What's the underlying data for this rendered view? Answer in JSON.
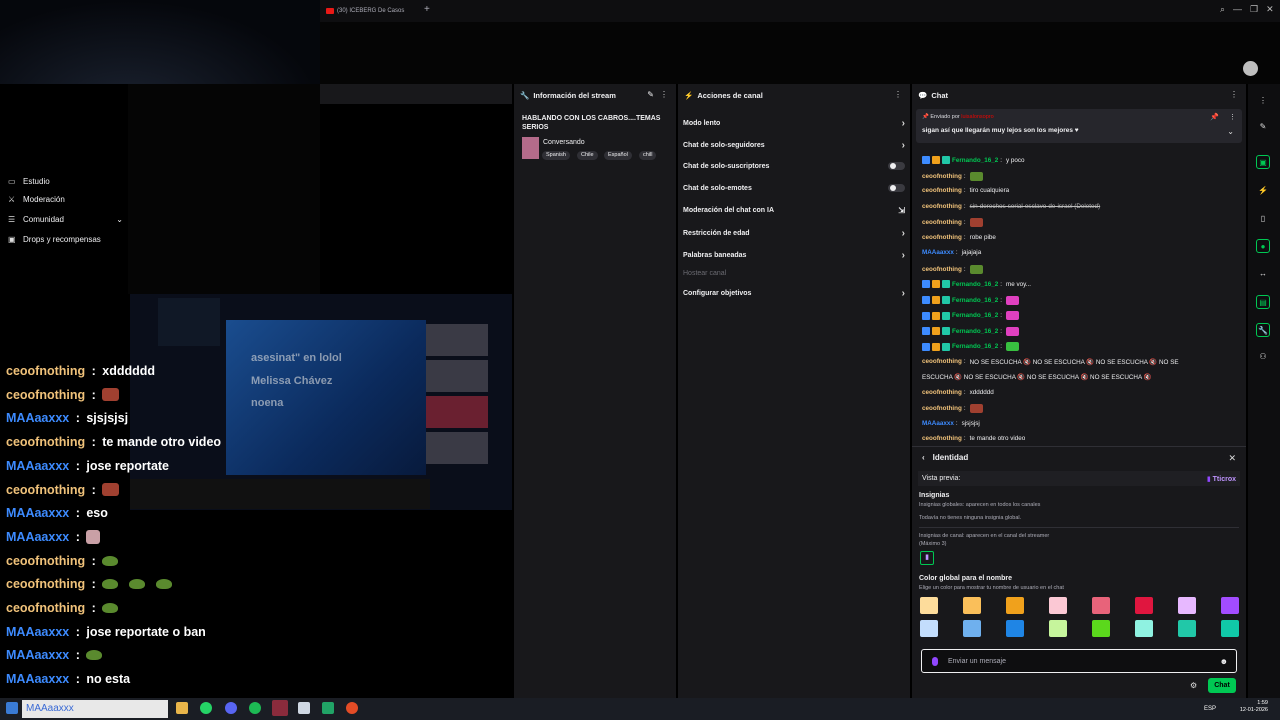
{
  "browser": {
    "tab_title": "(30) ICEBERG De Casos",
    "new_tab": "+",
    "window_controls": [
      "⌕",
      "—",
      "❐",
      "✕"
    ]
  },
  "left_menu": {
    "items": [
      {
        "label": "Estudio",
        "icon": "studio-icon"
      },
      {
        "label": "Moderación",
        "icon": "sword-icon"
      },
      {
        "label": "Comunidad",
        "icon": "people-icon"
      },
      {
        "label": "Drops y recompensas",
        "icon": "gift-icon"
      }
    ]
  },
  "overlay_chat": [
    {
      "user": "ceoofnothing",
      "sep": " : ",
      "text": "xdddddd",
      "emotes": 0,
      "emote_type": "",
      "color": "#f0c27a"
    },
    {
      "user": "ceoofnothing",
      "sep": " : ",
      "text": "",
      "emotes": 1,
      "emote_type": "face",
      "color": "#f0c27a"
    },
    {
      "user": "MAAaaxxx",
      "sep": " : ",
      "text": "sjsjsjsj",
      "emotes": 0,
      "emote_type": "",
      "color": "#3d8bff"
    },
    {
      "user": "ceoofnothing",
      "sep": " : ",
      "text": "te mande otro video",
      "emotes": 0,
      "emote_type": "",
      "color": "#f0c27a"
    },
    {
      "user": "MAAaaxxx",
      "sep": " : ",
      "text": "jose reportate",
      "emotes": 0,
      "emote_type": "",
      "color": "#3d8bff"
    },
    {
      "user": "ceoofnothing",
      "sep": " : ",
      "text": "",
      "emotes": 1,
      "emote_type": "face",
      "color": "#f0c27a"
    },
    {
      "user": "MAAaaxxx",
      "sep": " : ",
      "text": "eso",
      "emotes": 0,
      "emote_type": "",
      "color": "#3d8bff"
    },
    {
      "user": "MAAaaxxx",
      "sep": " : ",
      "text": "",
      "emotes": 1,
      "emote_type": "hand",
      "color": "#3d8bff"
    },
    {
      "user": "ceoofnothing",
      "sep": " : ",
      "text": "",
      "emotes": 1,
      "emote_type": "frog",
      "color": "#f0c27a"
    },
    {
      "user": "ceoofnothing",
      "sep": " : ",
      "text": "",
      "emotes": 3,
      "emote_type": "frog",
      "color": "#f0c27a"
    },
    {
      "user": "ceoofnothing",
      "sep": " : ",
      "text": "",
      "emotes": 1,
      "emote_type": "frog",
      "color": "#f0c27a"
    },
    {
      "user": "MAAaaxxx",
      "sep": " : ",
      "text": "jose reportate o ban",
      "emotes": 0,
      "emote_type": "",
      "color": "#3d8bff"
    },
    {
      "user": "MAAaaxxx",
      "sep": " : ",
      "text": "",
      "emotes": 1,
      "emote_type": "frog",
      "color": "#3d8bff"
    },
    {
      "user": "MAAaaxxx",
      "sep": " : ",
      "text": "no esta",
      "emotes": 0,
      "emote_type": "",
      "color": "#3d8bff"
    }
  ],
  "overlay_preview_texts": [
    "asesinat\" en lolol",
    "Melissa Chávez",
    "noena"
  ],
  "stream_info": {
    "header": "Información del stream",
    "title": "HABLANDO CON LOS CABROS....TEMAS SERIOS",
    "category": "Conversando",
    "tags": [
      "Spanish",
      "Chile",
      "Español",
      "chill"
    ]
  },
  "channel_actions": {
    "header": "Acciones de canal",
    "items": [
      {
        "label": "Modo lento",
        "kind": "chevron"
      },
      {
        "label": "Chat de solo-seguidores",
        "kind": "chevron"
      },
      {
        "label": "Chat de solo-suscriptores",
        "kind": "toggle"
      },
      {
        "label": "Chat de solo-emotes",
        "kind": "toggle"
      },
      {
        "label": "Moderación del chat con IA",
        "kind": "external"
      },
      {
        "label": "Restricción de edad",
        "kind": "chevron"
      },
      {
        "label": "Palabras baneadas",
        "kind": "chevron"
      },
      {
        "label": "Hostear canal",
        "kind": "disabled"
      },
      {
        "label": "Configurar objetivos",
        "kind": "chevron"
      }
    ]
  },
  "chat": {
    "header": "Chat",
    "pinned": {
      "sent_by_prefix": "Enviado por",
      "sent_by_user": "luisalonsopro",
      "message": "sigan así que llegarán muy lejos son los mejores ♥"
    },
    "messages": [
      {
        "user": "Fernando_16_2",
        "text": "y poco",
        "color": "#00c853",
        "badges": true,
        "emote": ""
      },
      {
        "user": "ceoofnothing",
        "text": "",
        "color": "#f0c27a",
        "badges": false,
        "emote": "frog"
      },
      {
        "user": "ceoofnothing",
        "text": "tiro cualquiera",
        "color": "#f0c27a",
        "badges": false,
        "emote": ""
      },
      {
        "user": "ceoofnothing",
        "text": "sin-derechos-serial-esclavo-de-israel (Deleted)",
        "color": "#f0c27a",
        "badges": false,
        "emote": "",
        "deleted": true
      },
      {
        "user": "ceoofnothing",
        "text": "",
        "color": "#f0c27a",
        "badges": false,
        "emote": "face"
      },
      {
        "user": "ceoofnothing",
        "text": "robe pibe",
        "color": "#f0c27a",
        "badges": false,
        "emote": ""
      },
      {
        "user": "MAAaaxxx",
        "text": "jajajaja",
        "color": "#3d8bff",
        "badges": false,
        "emote": ""
      },
      {
        "user": "ceoofnothing",
        "text": "",
        "color": "#f0c27a",
        "badges": false,
        "emote": "frog"
      },
      {
        "user": "Fernando_16_2",
        "text": "me voy...",
        "color": "#00c853",
        "badges": true,
        "emote": ""
      },
      {
        "user": "Fernando_16_2",
        "text": "",
        "color": "#00c853",
        "badges": true,
        "emote": "pink"
      },
      {
        "user": "Fernando_16_2",
        "text": "",
        "color": "#00c853",
        "badges": true,
        "emote": "pink"
      },
      {
        "user": "Fernando_16_2",
        "text": "",
        "color": "#00c853",
        "badges": true,
        "emote": "pink"
      },
      {
        "user": "Fernando_16_2",
        "text": "",
        "color": "#00c853",
        "badges": true,
        "emote": "green"
      },
      {
        "user": "ceoofnothing",
        "text": "NO SE ESCUCHA 🔇 NO SE ESCUCHA 🔇 NO SE ESCUCHA 🔇 NO SE",
        "color": "#f0c27a",
        "badges": false,
        "emote": ""
      },
      {
        "user": "",
        "text": "ESCUCHA 🔇 NO SE ESCUCHA 🔇 NO SE ESCUCHA 🔇 NO SE ESCUCHA 🔇",
        "color": "#f0c27a",
        "badges": false,
        "emote": ""
      },
      {
        "user": "ceoofnothing",
        "text": "xdddddd",
        "color": "#f0c27a",
        "badges": false,
        "emote": ""
      },
      {
        "user": "ceoofnothing",
        "text": "",
        "color": "#f0c27a",
        "badges": false,
        "emote": "face"
      },
      {
        "user": "MAAaaxxx",
        "text": "sjsjsjsj",
        "color": "#3d8bff",
        "badges": false,
        "emote": ""
      },
      {
        "user": "ceoofnothing",
        "text": "te mande otro video",
        "color": "#f0c27a",
        "badges": false,
        "emote": ""
      }
    ],
    "input_placeholder": "Enviar un mensaje",
    "send_label": "Chat"
  },
  "identity": {
    "title": "Identidad",
    "preview_label": "Vista previa:",
    "preview_user": "Tticrox",
    "badges_heading": "Insignias",
    "global_badges_desc": "Insignias globales: aparecen en todos los canales",
    "no_global_badges": "Todavía no tienes ninguna insignia global.",
    "channel_badges_desc": "Insignias de canal: aparecen en el canal del streamer",
    "channel_badges_max": "(Máximo 3)",
    "color_heading": "Color global para el nombre",
    "color_desc": "Elige un color para mostrar tu nombre de usuario en el chat",
    "colors": [
      "#fddc9b",
      "#fabf5a",
      "#f0a11c",
      "#fbc8d4",
      "#e8637a",
      "#e0163f",
      "#e7b8ff",
      "#a24cff",
      "#c3ddfc",
      "#6fb0ee",
      "#1f85e5",
      "#c6f59c",
      "#5bd81c",
      "#8ff2e1",
      "#21c8a8",
      "#10c9a8"
    ]
  },
  "rail_icons": [
    "more-icon",
    "wand-icon",
    "video-icon",
    "lightning-icon",
    "shield-icon",
    "chat-icon",
    "activity-icon",
    "panel-icon",
    "wrench-icon",
    "users-icon"
  ],
  "taskbar": {
    "search_text": "MAAaaxxx",
    "language": "ESP",
    "time": "1:59",
    "date": "12-01-2026"
  }
}
